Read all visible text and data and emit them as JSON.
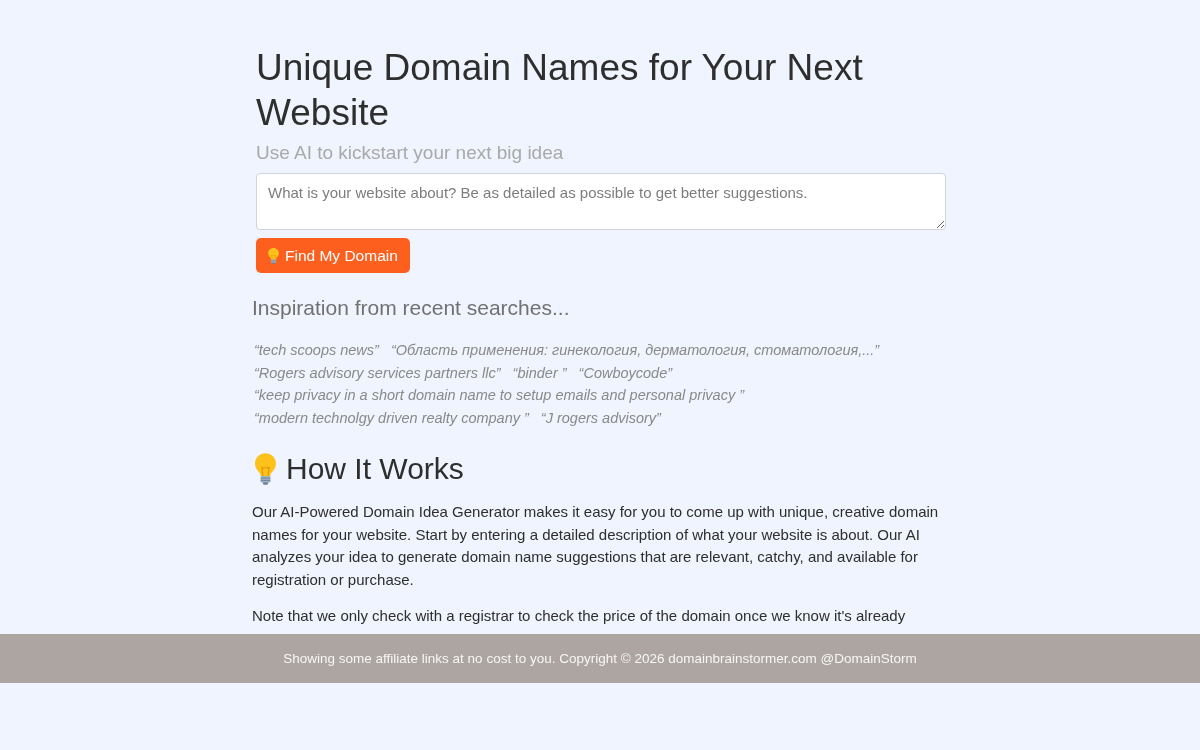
{
  "hero": {
    "title": "Unique Domain Names for Your Next Website",
    "subtitle": "Use AI to kickstart your next big idea",
    "description_field": {
      "placeholder": "What is your website about? Be as detailed as possible to get better suggestions."
    },
    "submit_button": {
      "label": "Find My Domain"
    }
  },
  "inspiration": {
    "heading": "Inspiration from recent searches...",
    "searches": [
      "“tech scoops news”",
      "“Область применения: гинекология, дерматология, стоматология,...”",
      "“Rogers advisory services partners llc”",
      "“binder ”",
      "“Cowboycode”",
      "“keep privacy in a short domain name to setup emails and personal privacy ”",
      "“modern technolgy driven realty company ”",
      "“J rogers advisory”"
    ]
  },
  "how_it_works": {
    "heading": "How It Works",
    "paragraphs": [
      "Our AI-Powered Domain Idea Generator makes it easy for you to come up with unique, creative domain names for your website. Start by entering a detailed description of what your website is about. Our AI analyzes your idea to generate domain name suggestions that are relevant, catchy, and available for registration or purchase.",
      "Note that we only check with a registrar to check the price of the domain once we know it's already"
    ]
  },
  "footer": {
    "text": "Showing some affiliate links at no cost to you. Copyright © 2026 domainbrainstormer.com @DomainStorm"
  }
}
